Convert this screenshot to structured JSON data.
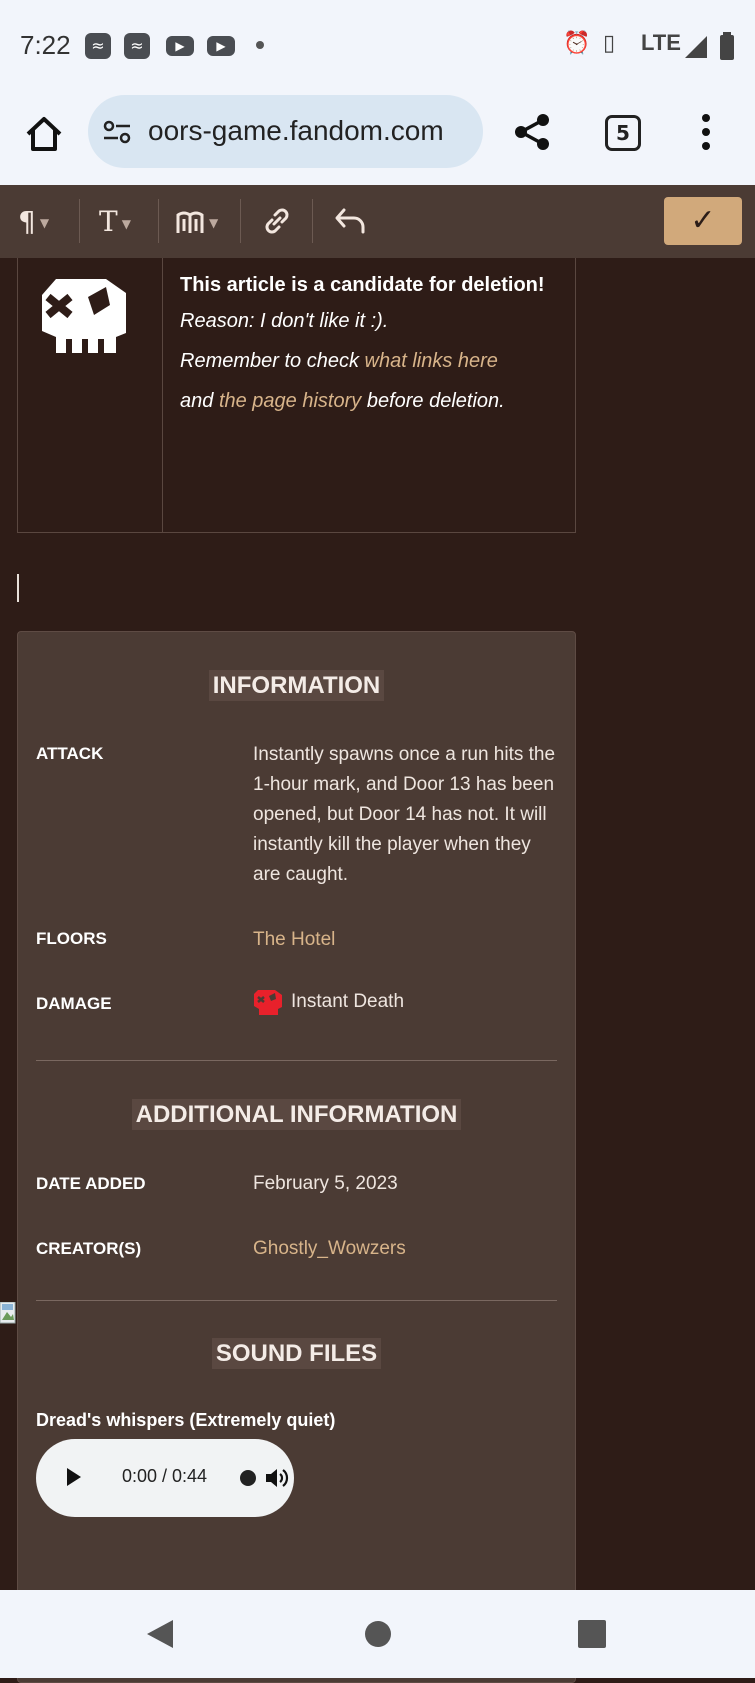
{
  "status_bar": {
    "time": "7:22",
    "network": "LTE"
  },
  "browser": {
    "url": "oors-game.fandom.com",
    "tab_count": "5"
  },
  "toolbar": {
    "paragraph_icon": "pilcrow-icon",
    "text_icon": "text-style-icon",
    "insert_icon": "book-insert-icon",
    "link_icon": "link-icon",
    "undo_icon": "undo-icon",
    "save_icon": "checkmark-icon"
  },
  "candidate": {
    "title": "This article is a candidate for deletion!",
    "reason": "Reason: I don't like it :).",
    "remember_prefix": "Remember to check ",
    "what_links": "what links here",
    "and_text": "and ",
    "page_history": "the page history",
    "before_text": " before deletion."
  },
  "infobox": {
    "information_title": "INFORMATION",
    "attack_label": "ATTACK",
    "attack_value": "Instantly spawns once a run hits the 1-hour mark, and Door 13 has been opened, but Door 14 has not. It will instantly kill the player when they are caught.",
    "floors_label": "FLOORS",
    "floors_value": "The Hotel",
    "damage_label": "DAMAGE",
    "damage_value": "Instant Death",
    "additional_title": "ADDITIONAL INFORMATION",
    "date_label": "DATE ADDED",
    "date_value": "February 5, 2023",
    "creator_label": "CREATOR(S)",
    "creator_value": "Ghostly_Wowzers",
    "sound_title": "SOUND FILES",
    "sound_name": "Dread's whispers (Extremely quiet)",
    "audio_time": "0:00 / 0:44"
  },
  "colors": {
    "accent": "#d8b48a",
    "background": "#2e1c17",
    "panel": "#4b3b34",
    "danger": "#e8212b"
  }
}
